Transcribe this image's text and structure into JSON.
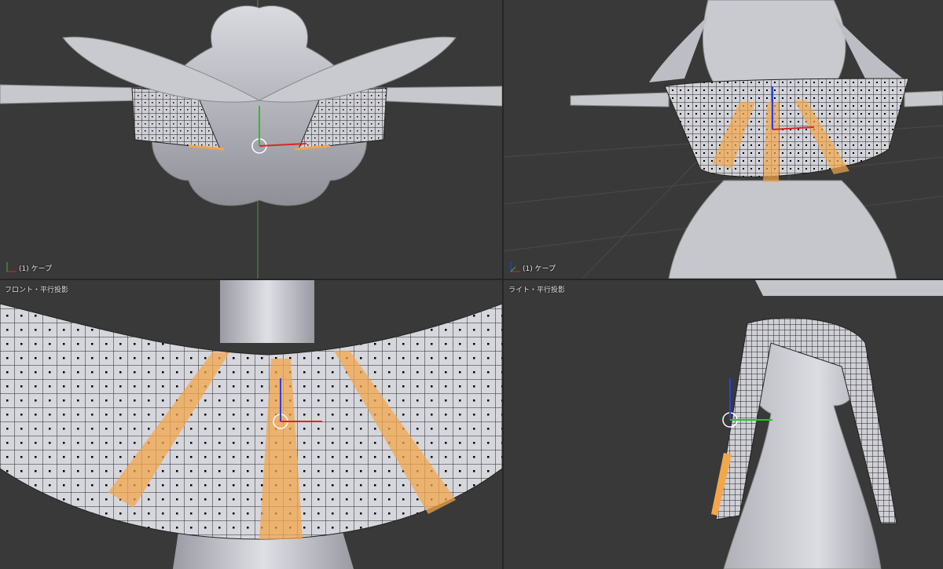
{
  "viewports": {
    "top_left": {
      "view_label": "",
      "object_label": "(1) ケープ"
    },
    "top_right": {
      "view_label": "",
      "object_label": "(1) ケープ"
    },
    "bottom_left": {
      "view_label": "フロント・平行投影",
      "object_label": ""
    },
    "bottom_right": {
      "view_label": "ライト・平行投影",
      "object_label": ""
    }
  },
  "colors": {
    "viewport_bg": "#393939",
    "mesh": "#b4b4bc",
    "selected_faces": "#f3a64a",
    "axis_x": "#d62828",
    "axis_y": "#27c12b",
    "axis_z": "#2a3fe6"
  }
}
